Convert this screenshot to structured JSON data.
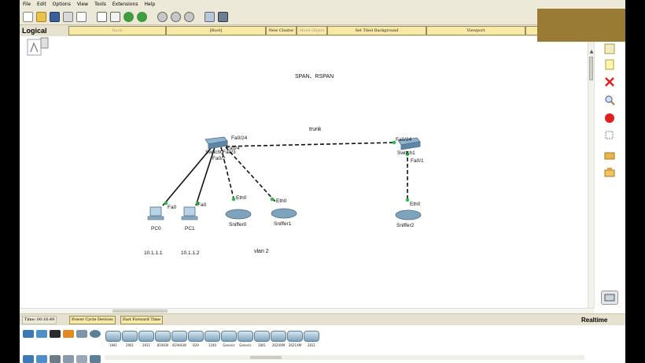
{
  "menu": [
    "File",
    "Edit",
    "Options",
    "View",
    "Tools",
    "Extensions",
    "Help"
  ],
  "logical_bar": {
    "title": "Logical",
    "back": "Back",
    "root": "[Root]",
    "new_cluster": "New Cluster",
    "move_object": "Move Object",
    "set_tiled_background": "Set Tiled Background",
    "viewport": "Viewport"
  },
  "topology": {
    "title": "SPAN、RSPAN",
    "trunk_label": "trunk",
    "vlan_label": "vlan 2",
    "switch0": {
      "name": "Switch0",
      "ports": [
        "Fa0/24",
        "Fa0/4",
        "Fa0/3",
        "Fa0/2"
      ]
    },
    "switch1": {
      "name": "Switch1",
      "ports": [
        "Fa0/24",
        "Fa0/1"
      ]
    },
    "pc0": {
      "name": "PC0",
      "port": "Fa0",
      "ip": "10.1.1.1"
    },
    "pc1": {
      "name": "PC1",
      "port": "Fa0",
      "ip": "10.1.1.2"
    },
    "sniffer0": {
      "name": "Sniffer0",
      "port": "Eth0"
    },
    "sniffer1": {
      "name": "Sniffer1",
      "port": "Eth0"
    },
    "sniffer2": {
      "name": "Sniffer2",
      "port": "Eth0"
    }
  },
  "status": {
    "time": "Time: 00:16:49",
    "power_cycle": "Power Cycle Devices",
    "fast_forward": "Fast Forward Time",
    "mode": "Realtime"
  },
  "devices": [
    "1941",
    "2901",
    "2911",
    "819IOX",
    "819HGW",
    "829",
    "1240",
    "Generic",
    "Generic",
    "1841",
    "2620XM",
    "2621XM",
    "2811"
  ],
  "colors": {
    "link_up": "#1fbf3f",
    "overlay": "#9a7b33",
    "button_bg": "#f7e9a6",
    "toolbar_bg": "#ece9d8"
  }
}
